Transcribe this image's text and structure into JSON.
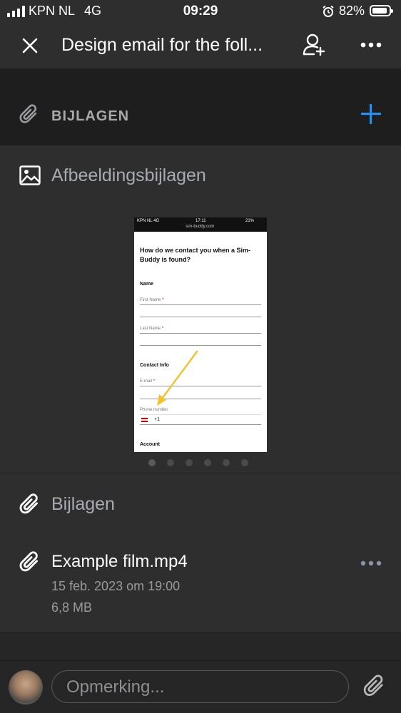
{
  "status_bar": {
    "carrier": "KPN NL",
    "network": "4G",
    "time": "09:29",
    "battery_percent": "82%",
    "battery_level": 0.82
  },
  "header": {
    "title": "Design email for the foll...",
    "close_icon": "close-icon",
    "share_icon": "add-person-icon",
    "more_icon": "more-horizontal-icon"
  },
  "attachments_bar": {
    "label": "BIJLAGEN",
    "icon": "paperclip-icon",
    "add_icon": "plus-icon",
    "accent": "#2f8fe0"
  },
  "image_attachments": {
    "title": "Afbeeldingsbijlagen",
    "icon": "image-icon",
    "preview": {
      "carrier": "KPN NL  4G",
      "time": "17:11",
      "battery": "21%",
      "url": "sim-buddy.com",
      "heading": "How do we contact you when a Sim-Buddy is found?",
      "name_section": "Name",
      "first_name_label": "First Name",
      "last_name_label": "Last Name",
      "contact_section": "Contact Info",
      "email_label": "E-mail",
      "phone_label": "Phone number",
      "phone_prefix": "+1",
      "account_section": "Account",
      "required_marker": "*"
    },
    "page_count": 6,
    "active_page": 1
  },
  "files_section": {
    "title": "Bijlagen",
    "icon": "paperclip-icon",
    "files": [
      {
        "name": "Example film.mp4",
        "date": "15 feb. 2023 om 19:00",
        "size": "6,8 MB"
      }
    ]
  },
  "comment_bar": {
    "placeholder": "Opmerking...",
    "attach_icon": "paperclip-icon",
    "avatar_icon": "avatar"
  }
}
